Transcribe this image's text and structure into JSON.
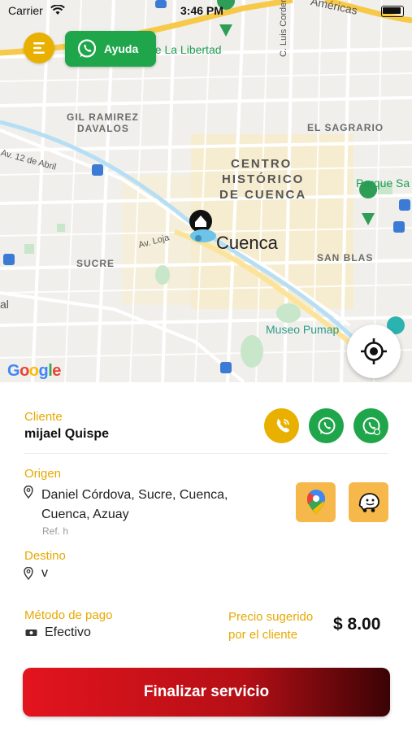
{
  "status_bar": {
    "carrier": "Carrier",
    "time": "3:46 PM"
  },
  "map": {
    "labels": {
      "americas": "Américas",
      "parque_libertad": "ue La Libertad",
      "luis_cordero": "C. Luis Cordero",
      "gil_ramirez": "GIL RAMIREZ",
      "davalos": "DAVALOS",
      "el_sagrario": "EL SAGRARIO",
      "av_12_abril": "Av. 12 de Abril",
      "centro_1": "CENTRO",
      "centro_2": "HISTÓRICO",
      "centro_3": "DE CUENCA",
      "parque_sa": "Parque Sa",
      "av_loja": "Av. Loja",
      "cuenca": "Cuenca",
      "sucre": "SUCRE",
      "san_blas": "SAN BLAS",
      "museo": "Museo Pumap",
      "al": "al"
    },
    "google_logo": "Google"
  },
  "top_controls": {
    "help_label": "Ayuda"
  },
  "client": {
    "section_label": "Cliente",
    "name": "mijael Quispe"
  },
  "origin": {
    "section_label": "Origen",
    "address": "Daniel Córdova, Sucre, Cuenca, Cuenca, Azuay",
    "reference": "Ref. h"
  },
  "destination": {
    "section_label": "Destino",
    "value": "v"
  },
  "payment": {
    "section_label": "Método de pago",
    "method": "Efectivo",
    "price_label": "Precio sugerido por el cliente",
    "price": "$ 8.00"
  },
  "finish_button": {
    "label": "Finalizar servicio"
  },
  "colors": {
    "accent": "#e7a800",
    "whatsapp": "#1fa64a",
    "primary_red": "#e3141e"
  }
}
